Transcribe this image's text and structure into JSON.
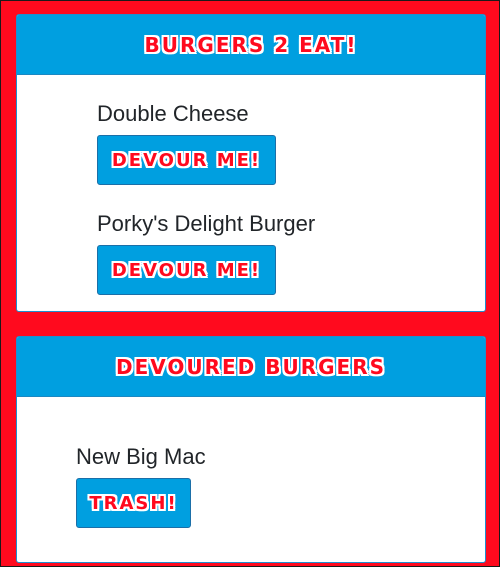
{
  "burgers_to_eat": {
    "title": "BURGERS 2 EAT!",
    "items": [
      {
        "name": "Double Cheese",
        "button": "DEVOUR ME!"
      },
      {
        "name": "Porky's Delight Burger",
        "button": "DEVOUR ME!"
      }
    ]
  },
  "devoured_burgers": {
    "title": "DEVOURED BURGERS",
    "items": [
      {
        "name": "New Big Mac",
        "button": "TRASH!"
      }
    ]
  },
  "colors": {
    "background": "#ff0a1e",
    "header": "#009fe0",
    "button": "#009fe0",
    "title_text": "#ff0a1e"
  }
}
